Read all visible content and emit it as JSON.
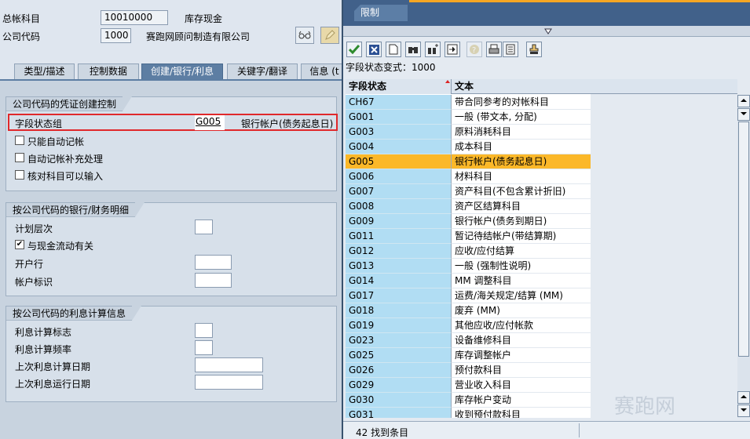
{
  "header": {
    "gl_account_label": "总帐科目",
    "gl_account_value": "10010000",
    "gl_account_desc": "库存现金",
    "company_code_label": "公司代码",
    "company_code_value": "1000",
    "company_name": "赛跑网顾问制造有限公司"
  },
  "tabs": [
    "类型/描述",
    "控制数据",
    "创建/银行/利息",
    "关键字/翻译",
    "信息 (t"
  ],
  "group1": {
    "title": "公司代码的凭证创建控制",
    "field_status_group_label": "字段状态组",
    "field_status_group_value": "G005",
    "field_status_group_desc": "银行帐户(债务起息日)",
    "post_auto_only": "只能自动记帐",
    "supplement_auto": "自动记帐补充处理",
    "recon_input": "核对科目可以输入"
  },
  "group2": {
    "title": "按公司代码的银行/财务明细",
    "planning_level": "计划层次",
    "cash_flow_relevant": "与现金流动有关",
    "cash_flow_checked": "✔",
    "house_bank": "开户行",
    "account_id": "帐户标识"
  },
  "group3": {
    "title": "按公司代码的利息计算信息",
    "interest_indicator": "利息计算标志",
    "interest_frequency": "利息计算频率",
    "last_calc_date": "上次利息计算日期",
    "last_run_date": "上次利息运行日期"
  },
  "popup": {
    "tab_label": "限制",
    "variant_line": "字段状态变式：1000",
    "col_status": "字段状态",
    "col_text": "文本",
    "status_text": "42 找到条目",
    "rows": [
      {
        "code": "CH67",
        "text": "带合同参考的对帐科目"
      },
      {
        "code": "G001",
        "text": "一般 (带文本, 分配)"
      },
      {
        "code": "G003",
        "text": "原料消耗科目"
      },
      {
        "code": "G004",
        "text": "成本科目"
      },
      {
        "code": "G005",
        "text": "银行帐户(债务起息日)"
      },
      {
        "code": "G006",
        "text": "材料科目"
      },
      {
        "code": "G007",
        "text": "资产科目(不包含累计折旧)"
      },
      {
        "code": "G008",
        "text": "资产区结算科目"
      },
      {
        "code": "G009",
        "text": "银行帐户(债务到期日)"
      },
      {
        "code": "G011",
        "text": "暂记待结帐户(带结算期)"
      },
      {
        "code": "G012",
        "text": "应收/应付结算"
      },
      {
        "code": "G013",
        "text": "一般 (强制性说明)"
      },
      {
        "code": "G014",
        "text": "MM 调整科目"
      },
      {
        "code": "G017",
        "text": "运费/海关规定/结算 (MM)"
      },
      {
        "code": "G018",
        "text": "废弃 (MM)"
      },
      {
        "code": "G019",
        "text": "其他应收/应付帐款"
      },
      {
        "code": "G023",
        "text": "设备维修科目"
      },
      {
        "code": "G025",
        "text": "库存调整帐户"
      },
      {
        "code": "G026",
        "text": "预付款科目"
      },
      {
        "code": "G029",
        "text": "营业收入科目"
      },
      {
        "code": "G030",
        "text": "库存帐户变动"
      },
      {
        "code": "G031",
        "text": "收到预付款科目"
      }
    ]
  },
  "watermark": "赛跑网"
}
